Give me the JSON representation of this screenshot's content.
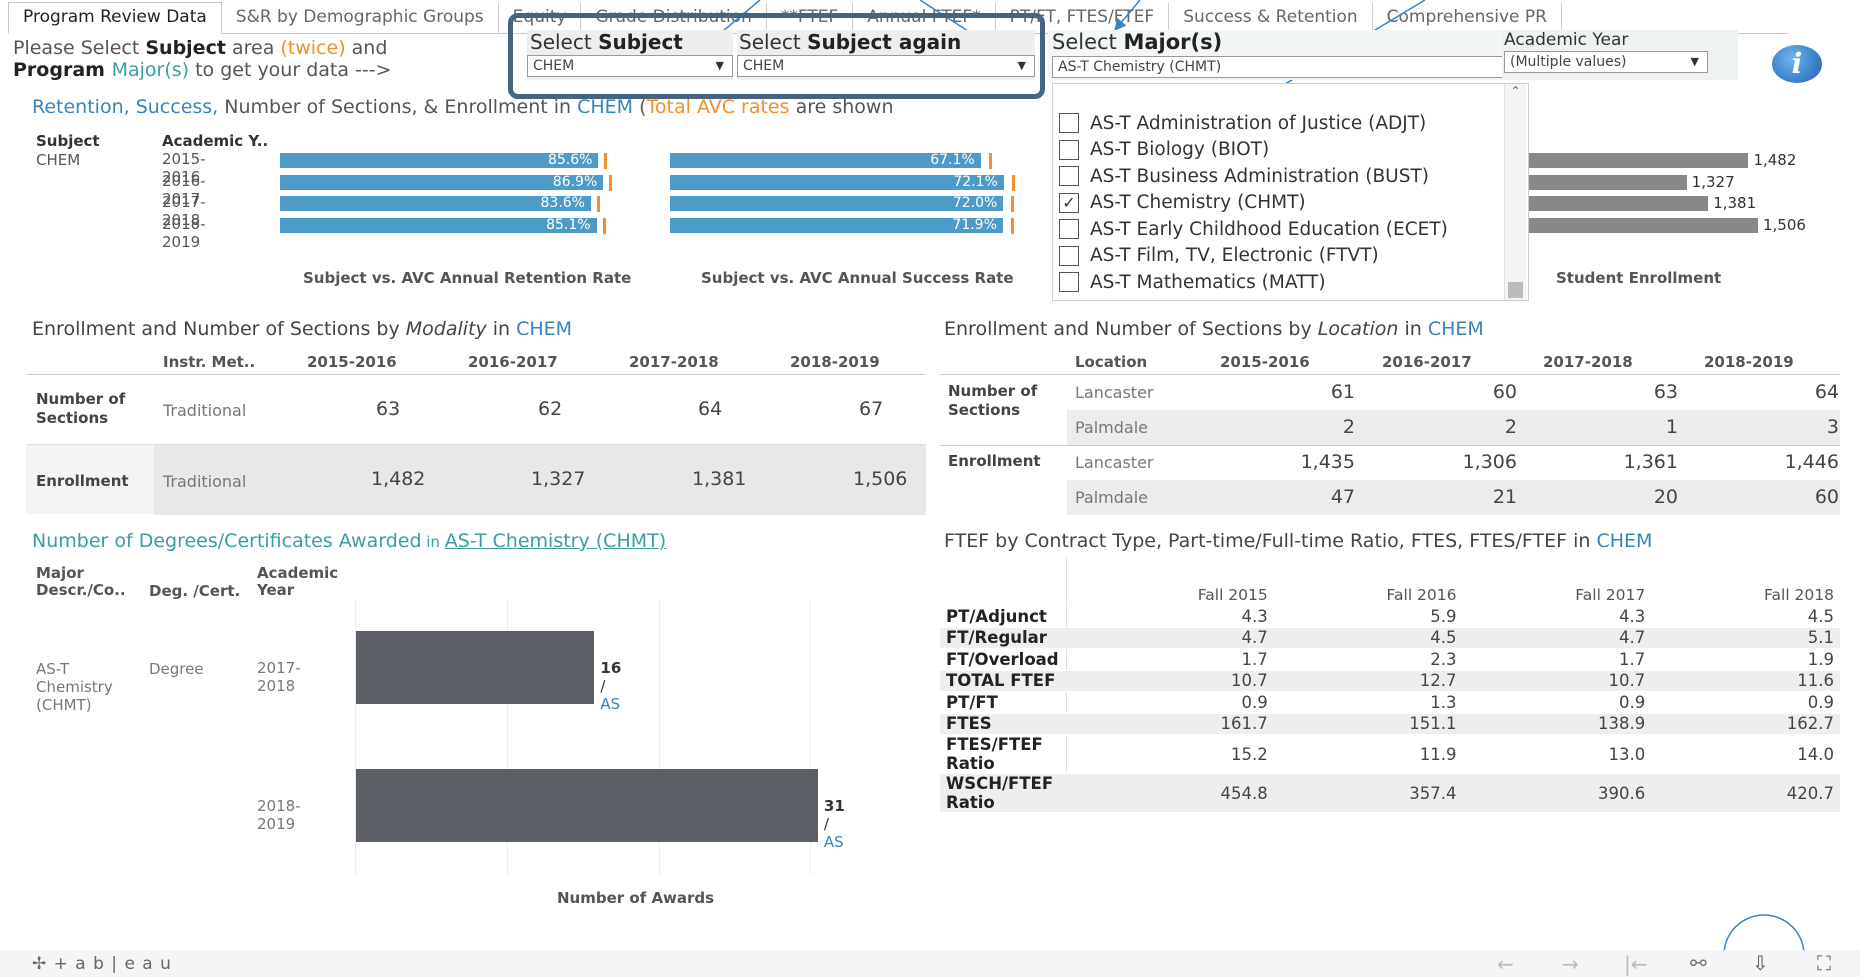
{
  "tabs": [
    {
      "label": "Program Review Data",
      "active": true
    },
    {
      "label": "S&R by Demographic Groups"
    },
    {
      "label": "Equity"
    },
    {
      "label": "Grade Distribution"
    },
    {
      "label": "**FTEF"
    },
    {
      "label": "Annual FTEF*"
    },
    {
      "label": "PT/FT, FTES/FTEF"
    },
    {
      "label": "Success & Retention"
    },
    {
      "label": "Comprehensive PR"
    }
  ],
  "instructions": {
    "t1": "Please Select ",
    "t2": "Subject",
    "t3": " area ",
    "t4": "(twice)",
    "t5": " and",
    "t6": "Program ",
    "t7": "Major(s)",
    "t8": "  to get your data --->"
  },
  "subject_filter": {
    "label_a": "Select ",
    "label_b": "Subject",
    "value": "CHEM"
  },
  "subject_filter2": {
    "label_a": "Select ",
    "label_b": "Subject ",
    "label_c": "again",
    "value": "CHEM"
  },
  "major_filter": {
    "label_a": "Select ",
    "label_b": "Major(s)",
    "value": "AS-T Chemistry (CHMT)",
    "options": [
      {
        "label": "AS-T Administration of Justice (ADJT)",
        "checked": false
      },
      {
        "label": "AS-T Biology (BIOT)",
        "checked": false
      },
      {
        "label": "AS-T Business Administration (BUST)",
        "checked": false
      },
      {
        "label": "AS-T Chemistry (CHMT)",
        "checked": true
      },
      {
        "label": "AS-T Early Childhood Education (ECET)",
        "checked": false
      },
      {
        "label": "AS-T Film, TV, Electronic (FTVT)",
        "checked": false
      },
      {
        "label": "AS-T Mathematics (MATT)",
        "checked": false
      }
    ],
    "check_glyph": "✓"
  },
  "year_filter": {
    "label_a": "Ac",
    "label_b": "ademic Year",
    "value": "(Multiple values)"
  },
  "info_icon": "i",
  "retention": {
    "title_a": "Retention, Success,",
    "title_b": " Number of Sections,  & Enrollment in ",
    "title_c": "CHEM",
    "title_d": "  (",
    "title_e": "Total AVC rates",
    "title_f": " are shown",
    "col_subject": "Subject",
    "col_year": "Academic Y..",
    "subject": "CHEM",
    "footer_retention": "Subject vs. AVC Annual Retention Rate",
    "footer_success": "Subject vs. AVC Annual Success Rate",
    "footer_enrollment": "Student Enrollment",
    "rows": [
      {
        "year": "2015-2016",
        "retention": "85.6%",
        "success": "67.1%",
        "enrollment": "1,482"
      },
      {
        "year": "2016-2017",
        "retention": "86.9%",
        "success": "72.1%",
        "enrollment": "1,327"
      },
      {
        "year": "2017-2018",
        "retention": "83.6%",
        "success": "72.0%",
        "enrollment": "1,381"
      },
      {
        "year": "2018-2019",
        "retention": "85.1%",
        "success": "71.9%",
        "enrollment": "1,506"
      }
    ]
  },
  "modality": {
    "title_a": "Enrollment and Number of Sections by ",
    "title_b": "Modality",
    "title_c": " in ",
    "title_d": "CHEM",
    "col_instr": "Instr. Met..",
    "years": [
      "2015-2016",
      "2016-2017",
      "2017-2018",
      "2018-2019"
    ],
    "sections_label": "Number of Sections",
    "enrollment_label": "Enrollment",
    "method": "Traditional",
    "sections": [
      "63",
      "62",
      "64",
      "67"
    ],
    "enrollment": [
      "1,482",
      "1,327",
      "1,381",
      "1,506"
    ]
  },
  "location": {
    "title_a": "Enrollment and Number of Sections by ",
    "title_b": "Location",
    "title_c": "  in ",
    "title_d": "CHEM",
    "col_location": "Location",
    "years": [
      "2015-2016",
      "2016-2017",
      "2017-2018",
      "2018-2019"
    ],
    "sections_label": "Number of Sections",
    "enrollment_label": "Enrollment",
    "sections": [
      {
        "loc": "Lancaster",
        "vals": [
          "61",
          "60",
          "63",
          "64"
        ]
      },
      {
        "loc": "Palmdale",
        "vals": [
          "2",
          "2",
          "1",
          "3"
        ]
      }
    ],
    "enrollment": [
      {
        "loc": "Lancaster",
        "vals": [
          "1,435",
          "1,306",
          "1,361",
          "1,446"
        ]
      },
      {
        "loc": "Palmdale",
        "vals": [
          "47",
          "21",
          "20",
          "60"
        ]
      }
    ]
  },
  "degrees": {
    "title_a": "Number of Degrees/Certificates Awarded",
    "title_b": " in ",
    "title_c": "AS-T Chemistry (CHMT)",
    "col_major_a": "Major",
    "col_major_b": "Descr./Co..",
    "col_deg": "Deg. /Cert.",
    "col_year_a": "Academic",
    "col_year_b": "Year",
    "major_a": "AS-T",
    "major_b": "Chemistry",
    "major_c": "(CHMT)",
    "deg": "Degree",
    "xlabel": "Number of Awards",
    "sep": " / ",
    "rows": [
      {
        "year": "2017-2018",
        "count": "16",
        "type": "AS"
      },
      {
        "year": "2018-2019",
        "count": "31",
        "type": "AS"
      }
    ]
  },
  "ftef": {
    "title_a": "FTEF",
    "title_b": " by Contract Type, Part-time/Full-time Ratio, FTES, FTES/FTEF  in ",
    "title_c": "CHEM",
    "cols": [
      "Fall 2015",
      "Fall 2016",
      "Fall 2017",
      "Fall 2018"
    ],
    "rows": [
      {
        "label": "PT/Adjunct",
        "vals": [
          "4.3",
          "5.9",
          "4.3",
          "4.5"
        ]
      },
      {
        "label": "FT/Regular",
        "vals": [
          "4.7",
          "4.5",
          "4.7",
          "5.1"
        ]
      },
      {
        "label": "FT/Overload",
        "vals": [
          "1.7",
          "2.3",
          "1.7",
          "1.9"
        ]
      },
      {
        "label": "TOTAL FTEF",
        "vals": [
          "10.7",
          "12.7",
          "10.7",
          "11.6"
        ]
      },
      {
        "label": "PT/FT",
        "vals": [
          "0.9",
          "1.3",
          "0.9",
          "0.9"
        ]
      },
      {
        "label": "FTES",
        "vals": [
          "161.7",
          "151.1",
          "138.9",
          "162.7"
        ]
      },
      {
        "label": "FTES/FTEF Ratio",
        "vals": [
          "15.2",
          "11.9",
          "13.0",
          "14.0"
        ]
      },
      {
        "label": "WSCH/FTEF Ratio",
        "vals": [
          "454.8",
          "357.4",
          "390.6",
          "420.7"
        ]
      }
    ]
  },
  "footer": {
    "logo": "✢ + a b | e a u",
    "back": "←",
    "forward": "→",
    "first": "|←",
    "share": "⚯",
    "download": "⇩",
    "fullscreen": "⛶"
  }
}
